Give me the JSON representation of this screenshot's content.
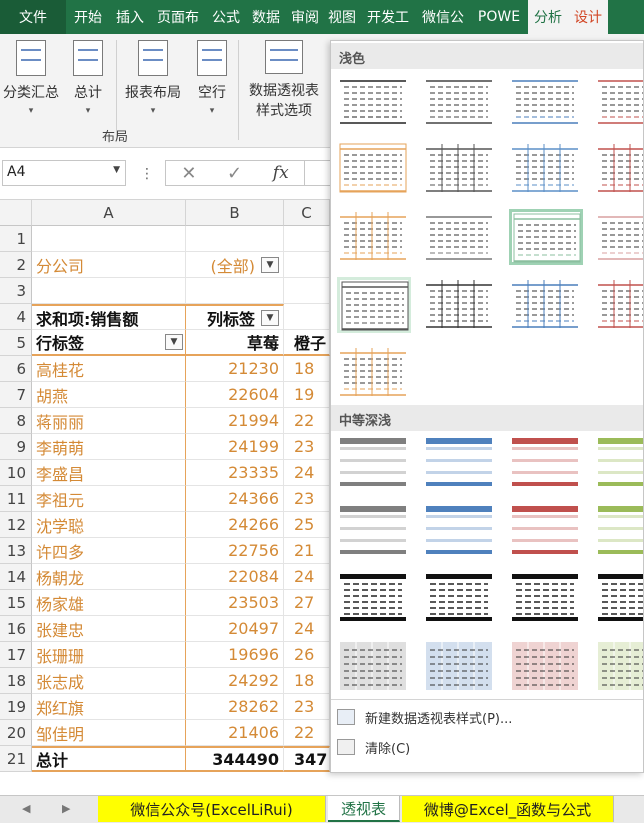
{
  "ribbon_tabs": [
    "文件",
    "开始",
    "插入",
    "页面布",
    "公式",
    "数据",
    "审阅",
    "视图",
    "开发工",
    "微信公",
    "POWE",
    "分析",
    "设计"
  ],
  "ribbon": {
    "subtotals": "分类汇总",
    "grand_totals": "总计",
    "report_layout": "报表布局",
    "blank_rows": "空行",
    "layout_group": "布局",
    "style_options_1": "数据透视表",
    "style_options_2": "样式选项"
  },
  "formula_bar": {
    "name_box": "A4",
    "fx": "fx"
  },
  "columns": [
    "A",
    "B",
    "C"
  ],
  "rows": [
    {
      "n": "1",
      "a": "",
      "b": "",
      "c": ""
    },
    {
      "n": "2",
      "a": "分公司",
      "b": "(全部)",
      "c": "",
      "style": "filter"
    },
    {
      "n": "3",
      "a": "",
      "b": "",
      "c": ""
    },
    {
      "n": "4",
      "a": "求和项:销售额",
      "b": "列标签",
      "c": "",
      "style": "header"
    },
    {
      "n": "5",
      "a": "行标签",
      "b": "草莓",
      "c": "橙子",
      "style": "header"
    },
    {
      "n": "6",
      "a": "高桂花",
      "b": "21230",
      "c": "18"
    },
    {
      "n": "7",
      "a": "胡燕",
      "b": "22604",
      "c": "19"
    },
    {
      "n": "8",
      "a": "蒋丽丽",
      "b": "21994",
      "c": "22"
    },
    {
      "n": "9",
      "a": "李萌萌",
      "b": "24199",
      "c": "23"
    },
    {
      "n": "10",
      "a": "李盛昌",
      "b": "23335",
      "c": "24"
    },
    {
      "n": "11",
      "a": "李祖元",
      "b": "24366",
      "c": "23"
    },
    {
      "n": "12",
      "a": "沈学聪",
      "b": "24266",
      "c": "25"
    },
    {
      "n": "13",
      "a": "许四多",
      "b": "22756",
      "c": "21"
    },
    {
      "n": "14",
      "a": "杨朝龙",
      "b": "22084",
      "c": "24"
    },
    {
      "n": "15",
      "a": "杨家雄",
      "b": "23503",
      "c": "27"
    },
    {
      "n": "16",
      "a": "张建忠",
      "b": "20497",
      "c": "24"
    },
    {
      "n": "17",
      "a": "张珊珊",
      "b": "19696",
      "c": "26"
    },
    {
      "n": "18",
      "a": "张志成",
      "b": "24292",
      "c": "18"
    },
    {
      "n": "19",
      "a": "郑红旗",
      "b": "28262",
      "c": "23"
    },
    {
      "n": "20",
      "a": "邹佳明",
      "b": "21406",
      "c": "22"
    },
    {
      "n": "21",
      "a": "总计",
      "b": "344490",
      "c": "347",
      "style": "total"
    }
  ],
  "gallery": {
    "light_header": "浅色",
    "medium_header": "中等深浅",
    "new_style": "新建数据透视表样式(P)...",
    "clear": "清除(C)",
    "colors": {
      "light": [
        "#222222",
        "#444444",
        "#4a7ebb",
        "#c0504d",
        "#e6a35a",
        "#555555",
        "#5b8fc7",
        "#c0504d",
        "#e6a35a",
        "#777777",
        "#8bbf9f",
        "#d9a0a0",
        "#555555",
        "#333333",
        "#4a7ebb",
        "#c0504d",
        "#e6a35a"
      ],
      "medium": [
        "#7f7f7f",
        "#4f81bd",
        "#c0504d",
        "#9bbb59"
      ]
    }
  },
  "sheet_tabs": [
    "微信公众号(ExcelLiRui)",
    "透视表",
    "微博@Excel_函数与公式"
  ]
}
